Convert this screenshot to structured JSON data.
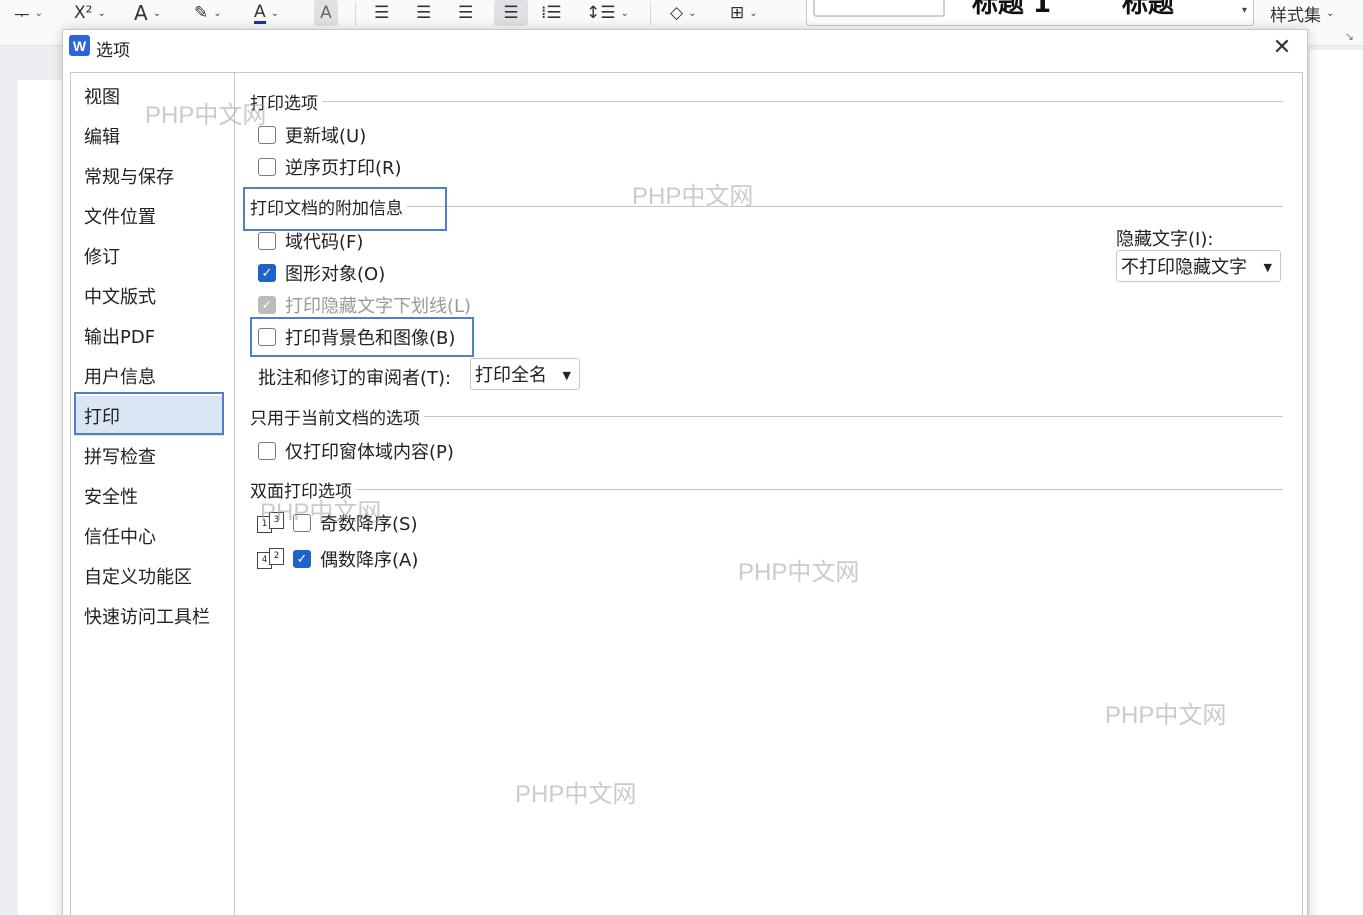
{
  "toolbar": {
    "items": [
      {
        "name": "strikethrough-menu",
        "glyph": "ᅮ"
      },
      {
        "name": "superscript-menu",
        "glyph": "X²"
      },
      {
        "name": "text-effect-menu",
        "glyph": "A"
      },
      {
        "name": "highlight-menu",
        "glyph": "✎"
      },
      {
        "name": "font-color-menu",
        "glyph": "A"
      },
      {
        "name": "char-shading",
        "glyph": "A"
      }
    ],
    "styles_label": "样式集",
    "style_preview_1": "标题 1",
    "style_preview_2": "标题"
  },
  "dialog": {
    "title": "选项",
    "logo": "W",
    "close_glyph": "✕"
  },
  "nav": {
    "items": [
      "视图",
      "编辑",
      "常规与保存",
      "文件位置",
      "修订",
      "中文版式",
      "输出PDF",
      "用户信息",
      "打印",
      "拼写检查",
      "安全性",
      "信任中心",
      "自定义功能区",
      "快速访问工具栏"
    ],
    "active_index": 8
  },
  "print_options": {
    "heading": "打印选项",
    "update_fields": {
      "label": "更新域(U)",
      "checked": false
    },
    "reverse_order": {
      "label": "逆序页打印(R)",
      "checked": false
    }
  },
  "extra_info": {
    "heading": "打印文档的附加信息",
    "field_codes": {
      "label": "域代码(F)",
      "checked": false
    },
    "drawing_objects": {
      "label": "图形对象(O)",
      "checked": true
    },
    "hidden_text_underline": {
      "label": "打印隐藏文字下划线(L)",
      "checked": true,
      "disabled": true
    },
    "background": {
      "label": "打印背景色和图像(B)",
      "checked": false
    },
    "reviewer_label": "批注和修订的审阅者(T):",
    "reviewer_value": "打印全名",
    "hidden_text_label": "隐藏文字(I):",
    "hidden_text_value": "不打印隐藏文字"
  },
  "current_doc": {
    "heading": "只用于当前文档的选项",
    "form_data_only": {
      "label": "仅打印窗体域内容(P)",
      "checked": false
    }
  },
  "duplex": {
    "heading": "双面打印选项",
    "odd_reverse": {
      "label": "奇数降序(S)",
      "checked": false,
      "icon_pages": [
        "1",
        "3"
      ]
    },
    "even_reverse": {
      "label": "偶数降序(A)",
      "checked": true,
      "icon_pages": [
        "4",
        "2"
      ]
    }
  },
  "watermarks": [
    "PHP中文网",
    "PHP中文网",
    "PHP中文网",
    "PHP中文网",
    "PHP中文网",
    "PHP中文网"
  ],
  "colors": {
    "accent": "#1d63c8",
    "highlight_border": "#4f80c6",
    "nav_active": "#dbe6f5"
  }
}
